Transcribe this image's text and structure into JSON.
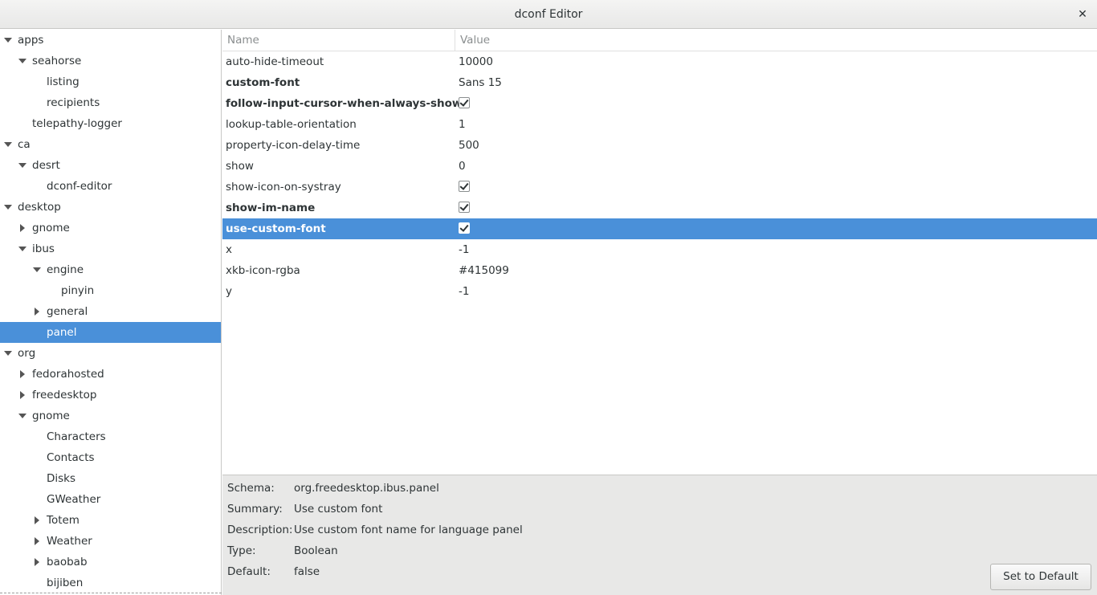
{
  "window": {
    "title": "dconf Editor",
    "close_glyph": "✕"
  },
  "tree": [
    {
      "label": "apps",
      "level": 0,
      "expander": "open"
    },
    {
      "label": "seahorse",
      "level": 1,
      "expander": "open"
    },
    {
      "label": "listing",
      "level": 2,
      "expander": "none"
    },
    {
      "label": "recipients",
      "level": 2,
      "expander": "none"
    },
    {
      "label": "telepathy-logger",
      "level": 1,
      "expander": "none"
    },
    {
      "label": "ca",
      "level": 0,
      "expander": "open"
    },
    {
      "label": "desrt",
      "level": 1,
      "expander": "open"
    },
    {
      "label": "dconf-editor",
      "level": 2,
      "expander": "none"
    },
    {
      "label": "desktop",
      "level": 0,
      "expander": "open"
    },
    {
      "label": "gnome",
      "level": 1,
      "expander": "closed"
    },
    {
      "label": "ibus",
      "level": 1,
      "expander": "open"
    },
    {
      "label": "engine",
      "level": 2,
      "expander": "open"
    },
    {
      "label": "pinyin",
      "level": 3,
      "expander": "none"
    },
    {
      "label": "general",
      "level": 2,
      "expander": "closed"
    },
    {
      "label": "panel",
      "level": 2,
      "expander": "none",
      "selected": true
    },
    {
      "label": "org",
      "level": 0,
      "expander": "open"
    },
    {
      "label": "fedorahosted",
      "level": 1,
      "expander": "closed"
    },
    {
      "label": "freedesktop",
      "level": 1,
      "expander": "closed"
    },
    {
      "label": "gnome",
      "level": 1,
      "expander": "open"
    },
    {
      "label": "Characters",
      "level": 2,
      "expander": "none"
    },
    {
      "label": "Contacts",
      "level": 2,
      "expander": "none"
    },
    {
      "label": "Disks",
      "level": 2,
      "expander": "none"
    },
    {
      "label": "GWeather",
      "level": 2,
      "expander": "none"
    },
    {
      "label": "Totem",
      "level": 2,
      "expander": "closed"
    },
    {
      "label": "Weather",
      "level": 2,
      "expander": "closed"
    },
    {
      "label": "baobab",
      "level": 2,
      "expander": "closed"
    },
    {
      "label": "bijiben",
      "level": 2,
      "expander": "none"
    }
  ],
  "keys_header": {
    "name": "Name",
    "value": "Value"
  },
  "keys": [
    {
      "name": "auto-hide-timeout",
      "value": "10000",
      "bold": false,
      "type": "text"
    },
    {
      "name": "custom-font",
      "value": "Sans 15",
      "bold": true,
      "type": "text"
    },
    {
      "name": "follow-input-cursor-when-always-shown",
      "value": "true",
      "bold": true,
      "type": "checkbox"
    },
    {
      "name": "lookup-table-orientation",
      "value": "1",
      "bold": false,
      "type": "text"
    },
    {
      "name": "property-icon-delay-time",
      "value": "500",
      "bold": false,
      "type": "text"
    },
    {
      "name": "show",
      "value": "0",
      "bold": false,
      "type": "text"
    },
    {
      "name": "show-icon-on-systray",
      "value": "true",
      "bold": false,
      "type": "checkbox"
    },
    {
      "name": "show-im-name",
      "value": "true",
      "bold": true,
      "type": "checkbox"
    },
    {
      "name": "use-custom-font",
      "value": "true",
      "bold": true,
      "type": "checkbox",
      "selected": true
    },
    {
      "name": "x",
      "value": "-1",
      "bold": false,
      "type": "text"
    },
    {
      "name": "xkb-icon-rgba",
      "value": "#415099",
      "bold": false,
      "type": "text"
    },
    {
      "name": "y",
      "value": "-1",
      "bold": false,
      "type": "text"
    }
  ],
  "details": {
    "schema_label": "Schema:",
    "schema_value": "org.freedesktop.ibus.panel",
    "summary_label": "Summary:",
    "summary_value": "Use custom font",
    "description_label": "Description:",
    "description_value": "Use custom font name for language panel",
    "type_label": "Type:",
    "type_value": "Boolean",
    "default_label": "Default:",
    "default_value": "false"
  },
  "set_default_label": "Set to Default",
  "colors": {
    "selection": "#4a90d9",
    "details_bg": "#e8e8e7",
    "text": "#2e3436"
  }
}
